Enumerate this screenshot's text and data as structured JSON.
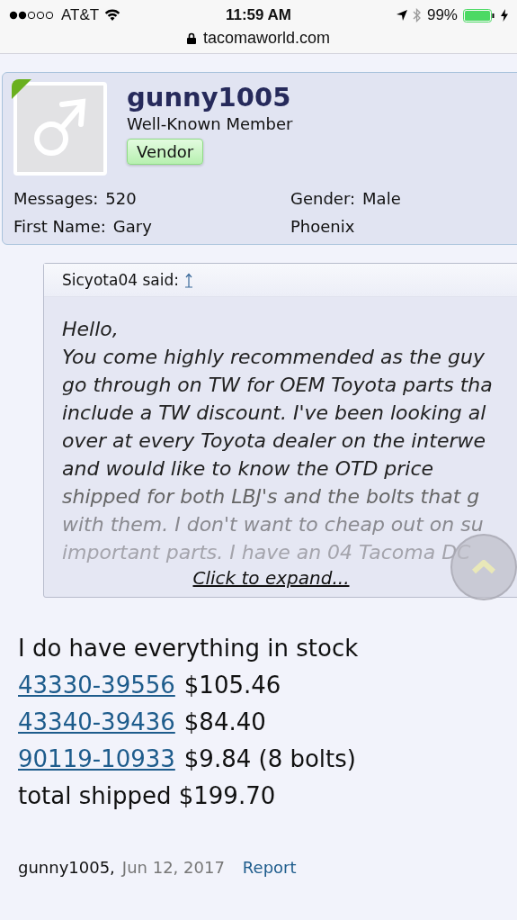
{
  "status_bar": {
    "carrier": "AT&T",
    "time": "11:59 AM",
    "battery": "99%",
    "url": "tacomaworld.com"
  },
  "profile": {
    "username": "gunny1005",
    "title": "Well-Known Member",
    "badge": "Vendor",
    "online": true,
    "stats": [
      {
        "label": "Messages:",
        "value": "520"
      },
      {
        "label": "Gender:",
        "value": "Male"
      },
      {
        "label": "First Name:",
        "value": "Gary"
      },
      {
        "value": "Phoenix"
      }
    ]
  },
  "quote": {
    "author": "Sicyota04 said:",
    "lines": [
      "Hello,",
      "You come highly recommended as the guy",
      "go through on TW for OEM Toyota parts tha",
      "include a TW discount. I've been looking al",
      "over at every Toyota dealer on the interwe",
      "and would like to know the OTD price",
      "shipped for both LBJ's and the bolts that g",
      "with them. I don't want to cheap out on su",
      "important parts. I have an 04 Tacoma DC"
    ],
    "expand": "Click to expand..."
  },
  "message": {
    "intro": "I do have everything in stock",
    "items": [
      {
        "part": "43330-39556",
        "price": "$105.46"
      },
      {
        "part": "43340-39436",
        "price": "$84.40"
      },
      {
        "part": "90119-10933",
        "price": "$9.84 (8 bolts)"
      }
    ],
    "total": "total shipped $199.70"
  },
  "footer": {
    "author": "gunny1005,",
    "date": "Jun 12, 2017",
    "report": "Report"
  }
}
